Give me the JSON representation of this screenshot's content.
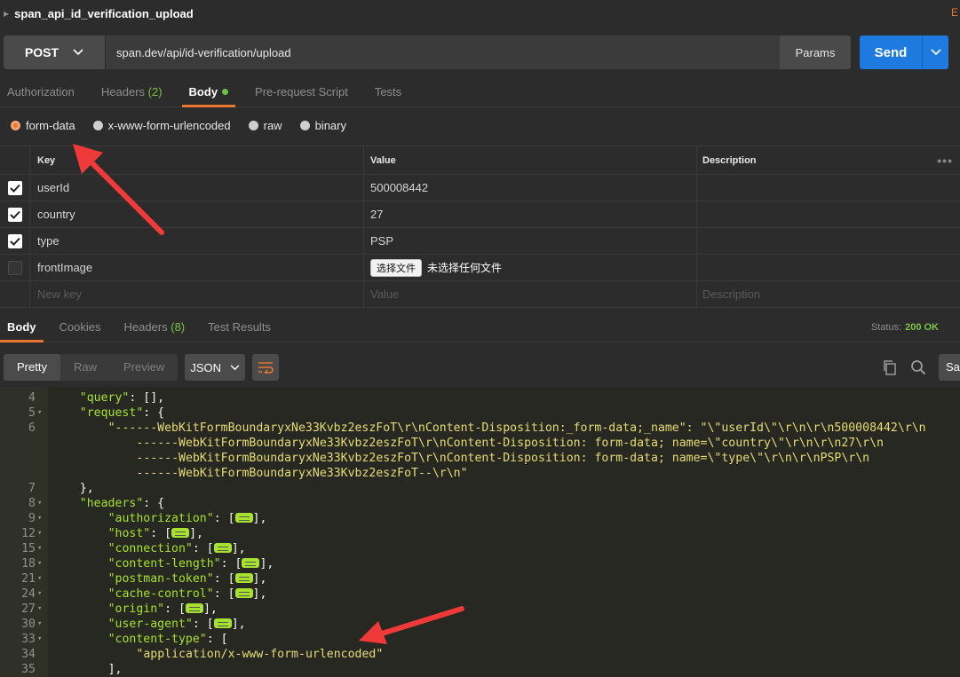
{
  "request": {
    "name": "span_api_id_verification_upload",
    "edge_letter": "E",
    "method": "POST",
    "url": "span.dev/api/id-verification/upload",
    "params_label": "Params",
    "send_label": "Send"
  },
  "request_tabs": [
    {
      "label": "Authorization"
    },
    {
      "label": "Headers",
      "count": "(2)"
    },
    {
      "label": "Body"
    },
    {
      "label": "Pre-request Script"
    },
    {
      "label": "Tests"
    }
  ],
  "body_types": [
    "form-data",
    "x-www-form-urlencoded",
    "raw",
    "binary"
  ],
  "form_table": {
    "headers": {
      "key": "Key",
      "value": "Value",
      "description": "Description"
    },
    "rows": [
      {
        "key": "userId",
        "value": "500008442"
      },
      {
        "key": "country",
        "value": "27"
      },
      {
        "key": "type",
        "value": "PSP"
      },
      {
        "key": "frontImage",
        "file_button": "选择文件",
        "file_status": "未选择任何文件"
      }
    ],
    "new_row": {
      "key": "New key",
      "value": "Value",
      "description": "Description"
    }
  },
  "response_tabs": [
    {
      "label": "Body"
    },
    {
      "label": "Cookies"
    },
    {
      "label": "Headers",
      "count": "(8)"
    },
    {
      "label": "Test Results"
    }
  ],
  "status": {
    "label": "Status:",
    "value": "200 OK"
  },
  "response_toolbar": {
    "views": [
      "Pretty",
      "Raw",
      "Preview"
    ],
    "format": "JSON",
    "save_label": "Sav"
  },
  "code_lines": [
    {
      "n": "4",
      "fold": false,
      "indent": 2,
      "parts": [
        [
          "k",
          "\"query\""
        ],
        [
          "p",
          ": [],"
        ]
      ]
    },
    {
      "n": "5",
      "fold": true,
      "indent": 2,
      "parts": [
        [
          "k",
          "\"request\""
        ],
        [
          "p",
          ": {"
        ]
      ]
    },
    {
      "n": "6",
      "fold": false,
      "indent": 4,
      "parts": [
        [
          "s",
          "\"------WebKitFormBoundaryxNe33Kvbz2eszFoT\\r\\nContent-Disposition:_form-data;_name\": \"\\\"userId\\\"\\r\\n\\r\\n500008442\\r\\n"
        ]
      ]
    },
    {
      "n": "",
      "fold": false,
      "indent": 6,
      "parts": [
        [
          "s",
          "------WebKitFormBoundaryxNe33Kvbz2eszFoT\\r\\nContent-Disposition: form-data; name=\\\"country\\\"\\r\\n\\r\\n27\\r\\n"
        ]
      ]
    },
    {
      "n": "",
      "fold": false,
      "indent": 6,
      "parts": [
        [
          "s",
          "------WebKitFormBoundaryxNe33Kvbz2eszFoT\\r\\nContent-Disposition: form-data; name=\\\"type\\\"\\r\\n\\r\\nPSP\\r\\n"
        ]
      ]
    },
    {
      "n": "",
      "fold": false,
      "indent": 6,
      "parts": [
        [
          "s",
          "------WebKitFormBoundaryxNe33Kvbz2eszFoT--\\r\\n\""
        ]
      ]
    },
    {
      "n": "7",
      "fold": false,
      "indent": 2,
      "parts": [
        [
          "p",
          "},"
        ]
      ]
    },
    {
      "n": "8",
      "fold": true,
      "indent": 2,
      "parts": [
        [
          "k",
          "\"headers\""
        ],
        [
          "p",
          ": {"
        ]
      ]
    },
    {
      "n": "9",
      "fold": true,
      "indent": 4,
      "parts": [
        [
          "k",
          "\"authorization\""
        ],
        [
          "p",
          ": ["
        ],
        [
          "c",
          ""
        ],
        [
          "p",
          "],"
        ]
      ]
    },
    {
      "n": "12",
      "fold": true,
      "indent": 4,
      "parts": [
        [
          "k",
          "\"host\""
        ],
        [
          "p",
          ": ["
        ],
        [
          "c",
          ""
        ],
        [
          "p",
          "],"
        ]
      ]
    },
    {
      "n": "15",
      "fold": true,
      "indent": 4,
      "parts": [
        [
          "k",
          "\"connection\""
        ],
        [
          "p",
          ": ["
        ],
        [
          "c",
          ""
        ],
        [
          "p",
          "],"
        ]
      ]
    },
    {
      "n": "18",
      "fold": true,
      "indent": 4,
      "parts": [
        [
          "k",
          "\"content-length\""
        ],
        [
          "p",
          ": ["
        ],
        [
          "c",
          ""
        ],
        [
          "p",
          "],"
        ]
      ]
    },
    {
      "n": "21",
      "fold": true,
      "indent": 4,
      "parts": [
        [
          "k",
          "\"postman-token\""
        ],
        [
          "p",
          ": ["
        ],
        [
          "c",
          ""
        ],
        [
          "p",
          "],"
        ]
      ]
    },
    {
      "n": "24",
      "fold": true,
      "indent": 4,
      "parts": [
        [
          "k",
          "\"cache-control\""
        ],
        [
          "p",
          ": ["
        ],
        [
          "c",
          ""
        ],
        [
          "p",
          "],"
        ]
      ]
    },
    {
      "n": "27",
      "fold": true,
      "indent": 4,
      "parts": [
        [
          "k",
          "\"origin\""
        ],
        [
          "p",
          ": ["
        ],
        [
          "c",
          ""
        ],
        [
          "p",
          "],"
        ]
      ]
    },
    {
      "n": "30",
      "fold": true,
      "indent": 4,
      "parts": [
        [
          "k",
          "\"user-agent\""
        ],
        [
          "p",
          ": ["
        ],
        [
          "c",
          ""
        ],
        [
          "p",
          "],"
        ]
      ]
    },
    {
      "n": "33",
      "fold": true,
      "indent": 4,
      "parts": [
        [
          "k",
          "\"content-type\""
        ],
        [
          "p",
          ": ["
        ]
      ]
    },
    {
      "n": "34",
      "fold": false,
      "indent": 6,
      "parts": [
        [
          "s",
          "\"application/x-www-form-urlencoded\""
        ]
      ]
    },
    {
      "n": "35",
      "fold": false,
      "indent": 4,
      "parts": [
        [
          "p",
          "],"
        ]
      ]
    }
  ]
}
